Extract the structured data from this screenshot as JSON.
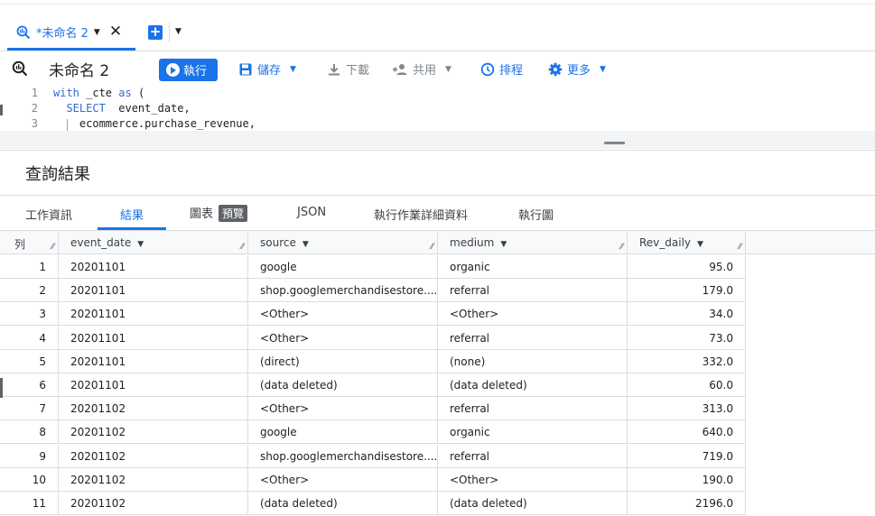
{
  "tabs": {
    "active_title": "*未命名 2"
  },
  "toolbar": {
    "title": "未命名 2",
    "run_label": "執行",
    "save_label": "儲存",
    "download_label": "下載",
    "share_label": "共用",
    "schedule_label": "排程",
    "more_label": "更多"
  },
  "editor": {
    "lines": [
      {
        "num": "1",
        "kw": "with",
        "rest": " _cte ",
        "kw2": "as",
        "rest2": " ("
      },
      {
        "num": "2",
        "kw": "  SELECT",
        "rest": "  event_date,",
        "kw2": "",
        "rest2": ""
      },
      {
        "num": "3",
        "kw": "",
        "rest": "    ecommerce.purchase_revenue,",
        "kw2": "",
        "rest2": ""
      }
    ]
  },
  "results": {
    "title": "查詢結果",
    "tabs": [
      "工作資訊",
      "結果",
      "圖表",
      "JSON",
      "執行作業詳細資料",
      "執行圖"
    ],
    "preview_badge": "預覽",
    "columns": [
      "列",
      "event_date",
      "source",
      "medium",
      "Rev_daily"
    ],
    "rows": [
      [
        "1",
        "20201101",
        "google",
        "organic",
        "95.0"
      ],
      [
        "2",
        "20201101",
        "shop.googlemerchandisestore....",
        "referral",
        "179.0"
      ],
      [
        "3",
        "20201101",
        "<Other>",
        "<Other>",
        "34.0"
      ],
      [
        "4",
        "20201101",
        "<Other>",
        "referral",
        "73.0"
      ],
      [
        "5",
        "20201101",
        "(direct)",
        "(none)",
        "332.0"
      ],
      [
        "6",
        "20201101",
        "(data deleted)",
        "(data deleted)",
        "60.0"
      ],
      [
        "7",
        "20201102",
        "<Other>",
        "referral",
        "313.0"
      ],
      [
        "8",
        "20201102",
        "google",
        "organic",
        "640.0"
      ],
      [
        "9",
        "20201102",
        "shop.googlemerchandisestore....",
        "referral",
        "719.0"
      ],
      [
        "10",
        "20201102",
        "<Other>",
        "<Other>",
        "190.0"
      ],
      [
        "11",
        "20201102",
        "(data deleted)",
        "(data deleted)",
        "2196.0"
      ]
    ]
  },
  "colors": {
    "accent": "#1a73e8",
    "border": "#dadce0",
    "header_bg": "#f8f9fa"
  }
}
